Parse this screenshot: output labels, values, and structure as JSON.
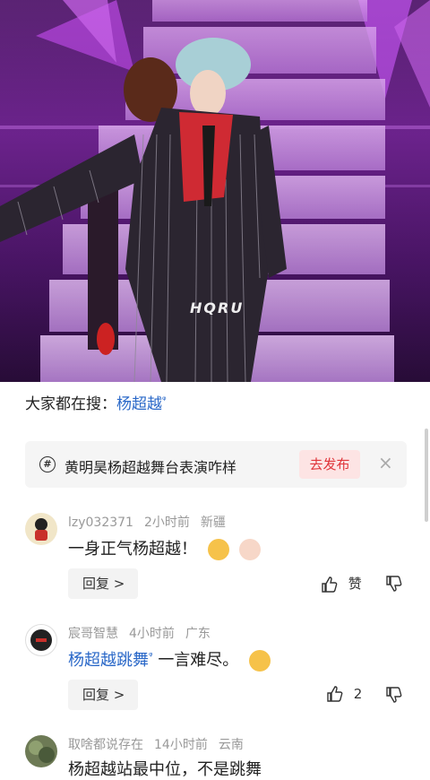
{
  "video": {
    "watermark": "HQRU"
  },
  "search_suggestion": {
    "prefix": "大家都在搜：",
    "keyword": "杨超越",
    "search_glyph": "ᵠ"
  },
  "topic": {
    "icon": "hash-icon",
    "title": "黄明昊杨超越舞台表演咋样",
    "publish_label": "去发布",
    "close_label": "×"
  },
  "comments": [
    {
      "user": "lzy032371",
      "time": "2小时前",
      "location": "新疆",
      "text": "一身正气杨超越！",
      "emojis": [
        "thumbs-up-emoji",
        "finger-heart-emoji"
      ],
      "reply_label": "回复 >",
      "like_label": "赞",
      "avatar_color": "#c8302a"
    },
    {
      "user": "宸哥智慧",
      "time": "4小时前",
      "location": "广东",
      "keyword": "杨超越跳舞",
      "text": "一言难尽。",
      "emojis": [
        "laughing-crying-emoji"
      ],
      "reply_label": "回复 >",
      "like_count": "2",
      "avatar_color": "#222222"
    },
    {
      "user": "取啥都说存在",
      "time": "14小时前",
      "location": "云南",
      "text": "杨超越站最中位，不是跳舞",
      "avatar_color": "#4a5a3a"
    }
  ]
}
